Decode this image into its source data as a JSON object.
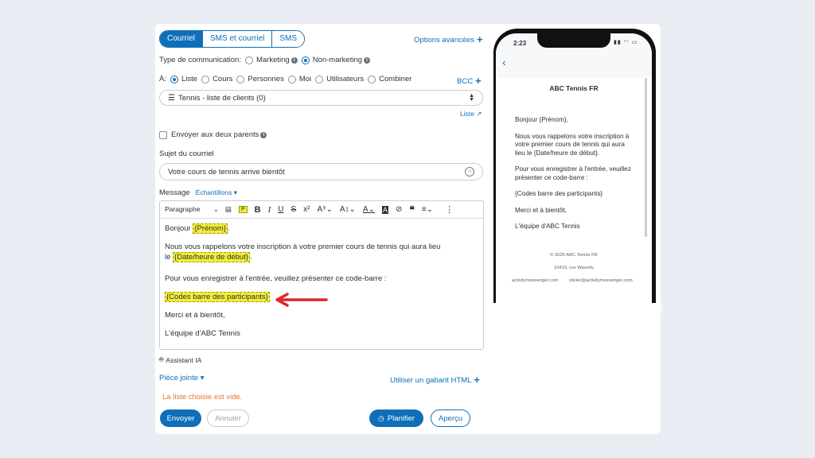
{
  "tabs": [
    "Courriel",
    "SMS et courriel",
    "SMS"
  ],
  "advanced_options": "Options avancées",
  "comm_type": {
    "label": "Type de communication:",
    "options": [
      "Marketing",
      "Non-marketing"
    ],
    "selected": "Non-marketing"
  },
  "recipients": {
    "label": "À:",
    "options": [
      "Liste",
      "Cours",
      "Personnes",
      "Moi",
      "Utilisateurs",
      "Combiner"
    ],
    "selected": "Liste",
    "bcc": "BCC"
  },
  "list_select": {
    "value": "Tennis - liste de clients (0)"
  },
  "list_link": "Liste",
  "both_parents": "Envoyer aux deux parents",
  "subject": {
    "label": "Sujet du courriel",
    "value": "Votre cours de tennis arrive bientôt"
  },
  "message": {
    "label": "Message",
    "samples": "Échantillons"
  },
  "toolbar": {
    "paragraph": "Paragraphe"
  },
  "email_body": {
    "greeting_prefix": "Bonjour",
    "greeting_var": "{Prénom}",
    "line1": "Nous vous rappelons votre inscription à votre premier cours de tennis qui aura lieu",
    "line2_prefix": "le",
    "date_var": "{Date/heure de début}",
    "line3": "Pour vous enregistrer à l'entrée, veuillez présenter ce code-barre :",
    "barcode_var": "{Codes barre des participants}",
    "closing": "Merci et à bientôt,",
    "signature": "L'équipe d'ABC Tennis"
  },
  "ai_assistant": "Assistant IA",
  "attachment": "Pièce jointe",
  "html_template": "Utiliser un gabarit HTML",
  "error": "La liste choisie est vide.",
  "buttons": {
    "send": "Envoyer",
    "cancel": "Annuler",
    "schedule": "Planifier",
    "preview": "Aperçu"
  },
  "phone": {
    "time": "2:23",
    "sender": "ABC Tennis FR",
    "greeting": "Bonjour {Prénom},",
    "para1": "Nous vous rappelons votre inscription à votre premier cours de tennis qui aura lieu le {Date/heure de début}.",
    "para2": "Pour vous enregistrer à l'entrée, veuillez présenter ce code-barre :",
    "barcode": "{Codes barre des participants}",
    "closing": "Merci et à bientôt,",
    "signature": "L'équipe d'ABC Tennis",
    "footer_copyright": "© 2025 ABC Tennis FR",
    "footer_address": "10410, rue Waverly",
    "footer_email1": "activitymessenger.com",
    "footer_email2": "olivier@activitymessenger.com"
  },
  "colors": {
    "accent": "#0e6fb8",
    "highlight": "#f3ee3b",
    "error": "#e8772e",
    "arrow": "#e0242a"
  }
}
